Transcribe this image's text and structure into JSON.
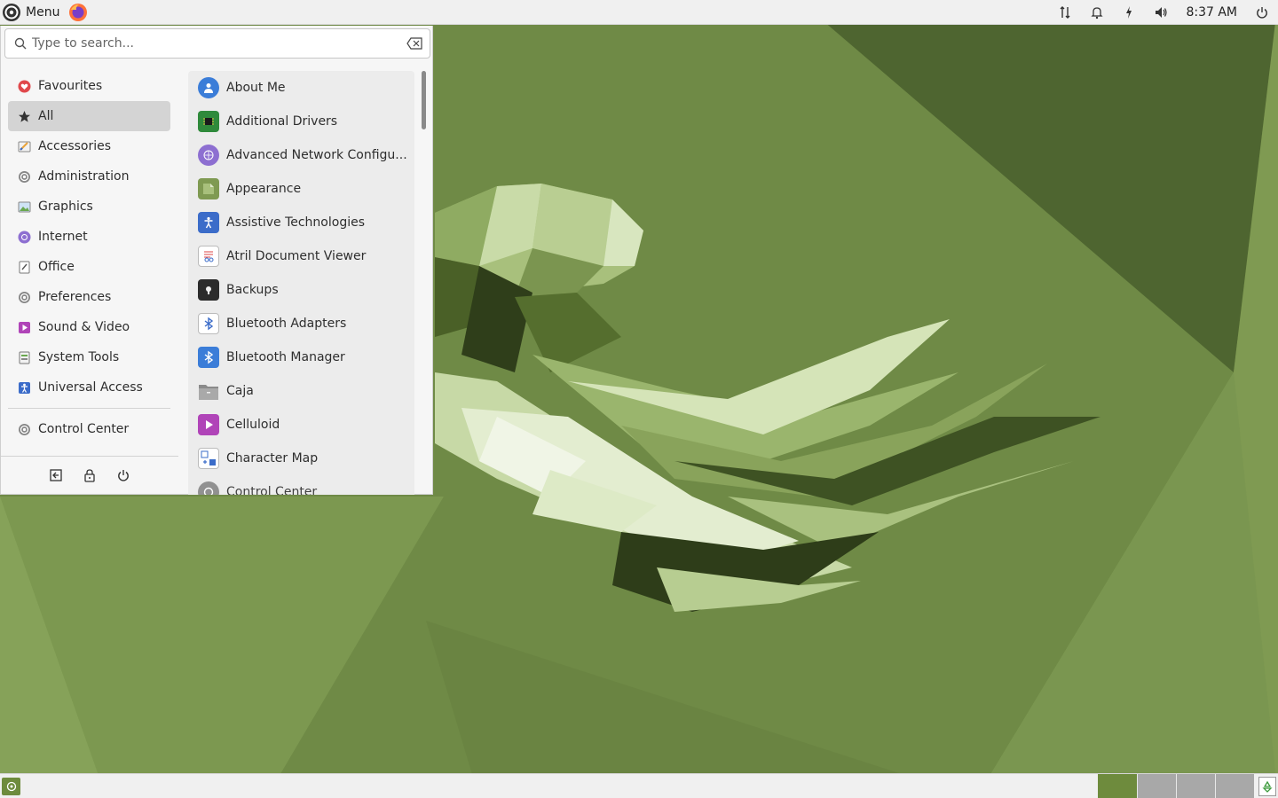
{
  "top_panel": {
    "menu_label": "Menu",
    "clock": "8:37 AM"
  },
  "menu": {
    "search_placeholder": "Type to search...",
    "categories": [
      {
        "label": "Favourites"
      },
      {
        "label": "All"
      },
      {
        "label": "Accessories"
      },
      {
        "label": "Administration"
      },
      {
        "label": "Graphics"
      },
      {
        "label": "Internet"
      },
      {
        "label": "Office"
      },
      {
        "label": "Preferences"
      },
      {
        "label": "Sound & Video"
      },
      {
        "label": "System Tools"
      },
      {
        "label": "Universal Access"
      }
    ],
    "control_center": "Control Center",
    "selected_category": "All",
    "apps": [
      {
        "label": "About Me"
      },
      {
        "label": "Additional Drivers"
      },
      {
        "label": "Advanced Network Configu..."
      },
      {
        "label": "Appearance"
      },
      {
        "label": "Assistive Technologies"
      },
      {
        "label": "Atril Document Viewer"
      },
      {
        "label": "Backups"
      },
      {
        "label": "Bluetooth Adapters"
      },
      {
        "label": "Bluetooth Manager"
      },
      {
        "label": "Caja"
      },
      {
        "label": "Celluloid"
      },
      {
        "label": "Character Map"
      },
      {
        "label": "Control Center"
      }
    ]
  },
  "colors": {
    "wallpaper": "#6f8a46",
    "accent_green": "#6e8b3d",
    "selected_bg": "#d4d4d4"
  }
}
